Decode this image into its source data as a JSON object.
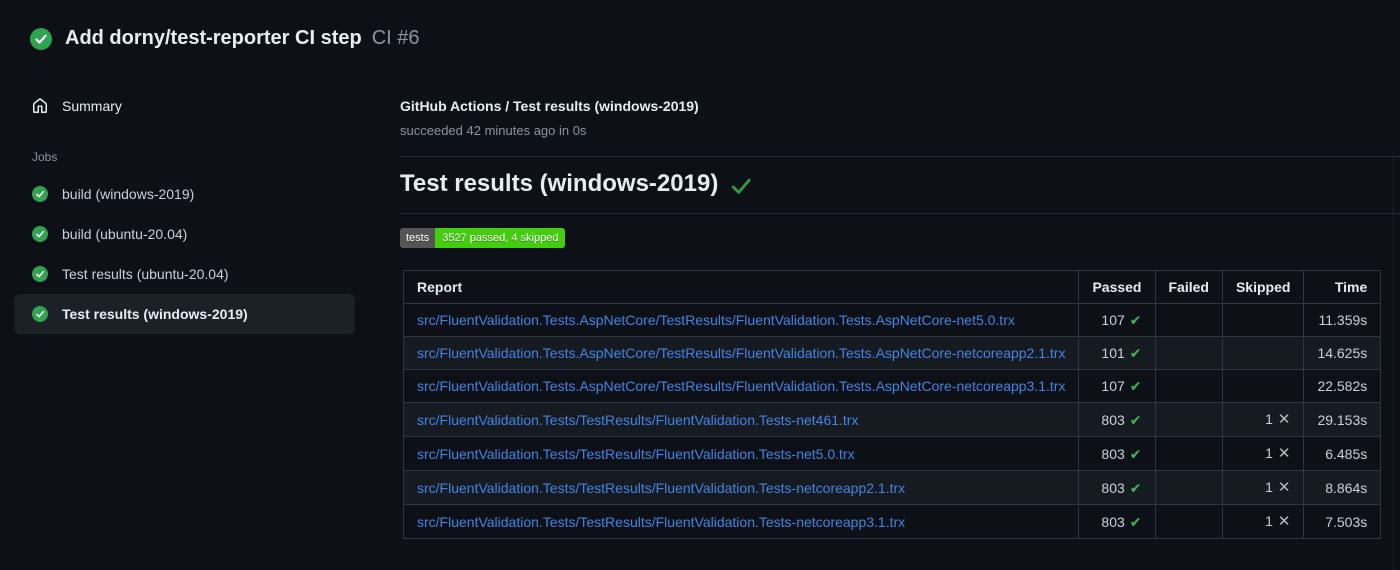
{
  "header": {
    "title": "Add dorny/test-reporter CI step",
    "run_number": "CI #6",
    "status_icon": "check-circle"
  },
  "sidebar": {
    "summary_label": "Summary",
    "summary_icon": "home",
    "jobs_label": "Jobs",
    "jobs": [
      {
        "label": "build (windows-2019)",
        "status_icon": "check-circle",
        "selected": false
      },
      {
        "label": "build (ubuntu-20.04)",
        "status_icon": "check-circle",
        "selected": false
      },
      {
        "label": "Test results (ubuntu-20.04)",
        "status_icon": "check-circle",
        "selected": false
      },
      {
        "label": "Test results (windows-2019)",
        "status_icon": "check-circle",
        "selected": true
      }
    ]
  },
  "main": {
    "check_title": "GitHub Actions / Test results (windows-2019)",
    "check_status": "succeeded 42 minutes ago in 0s",
    "section_heading": "Test results (windows-2019)",
    "heading_status_icon": "check",
    "badge": {
      "label": "tests",
      "value": "3527 passed, 4 skipped",
      "label_bg": "#555555",
      "value_bg": "#44cc11"
    },
    "table": {
      "columns": [
        "Report",
        "Passed",
        "Failed",
        "Skipped",
        "Time"
      ],
      "passed_icon": "check",
      "skipped_icon": "cross",
      "rows": [
        {
          "report": "src/FluentValidation.Tests.AspNetCore/TestResults/FluentValidation.Tests.AspNetCore-net5.0.trx",
          "passed": "107",
          "failed": "",
          "skipped": "",
          "time": "11.359s"
        },
        {
          "report": "src/FluentValidation.Tests.AspNetCore/TestResults/FluentValidation.Tests.AspNetCore-netcoreapp2.1.trx",
          "passed": "101",
          "failed": "",
          "skipped": "",
          "time": "14.625s"
        },
        {
          "report": "src/FluentValidation.Tests.AspNetCore/TestResults/FluentValidation.Tests.AspNetCore-netcoreapp3.1.trx",
          "passed": "107",
          "failed": "",
          "skipped": "",
          "time": "22.582s"
        },
        {
          "report": "src/FluentValidation.Tests/TestResults/FluentValidation.Tests-net461.trx",
          "passed": "803",
          "failed": "",
          "skipped": "1",
          "time": "29.153s"
        },
        {
          "report": "src/FluentValidation.Tests/TestResults/FluentValidation.Tests-net5.0.trx",
          "passed": "803",
          "failed": "",
          "skipped": "1",
          "time": "6.485s"
        },
        {
          "report": "src/FluentValidation.Tests/TestResults/FluentValidation.Tests-netcoreapp2.1.trx",
          "passed": "803",
          "failed": "",
          "skipped": "1",
          "time": "8.864s"
        },
        {
          "report": "src/FluentValidation.Tests/TestResults/FluentValidation.Tests-netcoreapp3.1.trx",
          "passed": "803",
          "failed": "",
          "skipped": "1",
          "time": "7.503s"
        }
      ]
    }
  },
  "colors": {
    "background": "#0d1117",
    "success_green": "#2ea44f",
    "check_green": "#3fb950",
    "link_blue": "#4184e4",
    "text_primary": "#e6edf3",
    "text_secondary": "#8b949e",
    "table_border": "#30363d",
    "row_stripe": "#161b22",
    "selected_item_bg": "#1c2128"
  }
}
